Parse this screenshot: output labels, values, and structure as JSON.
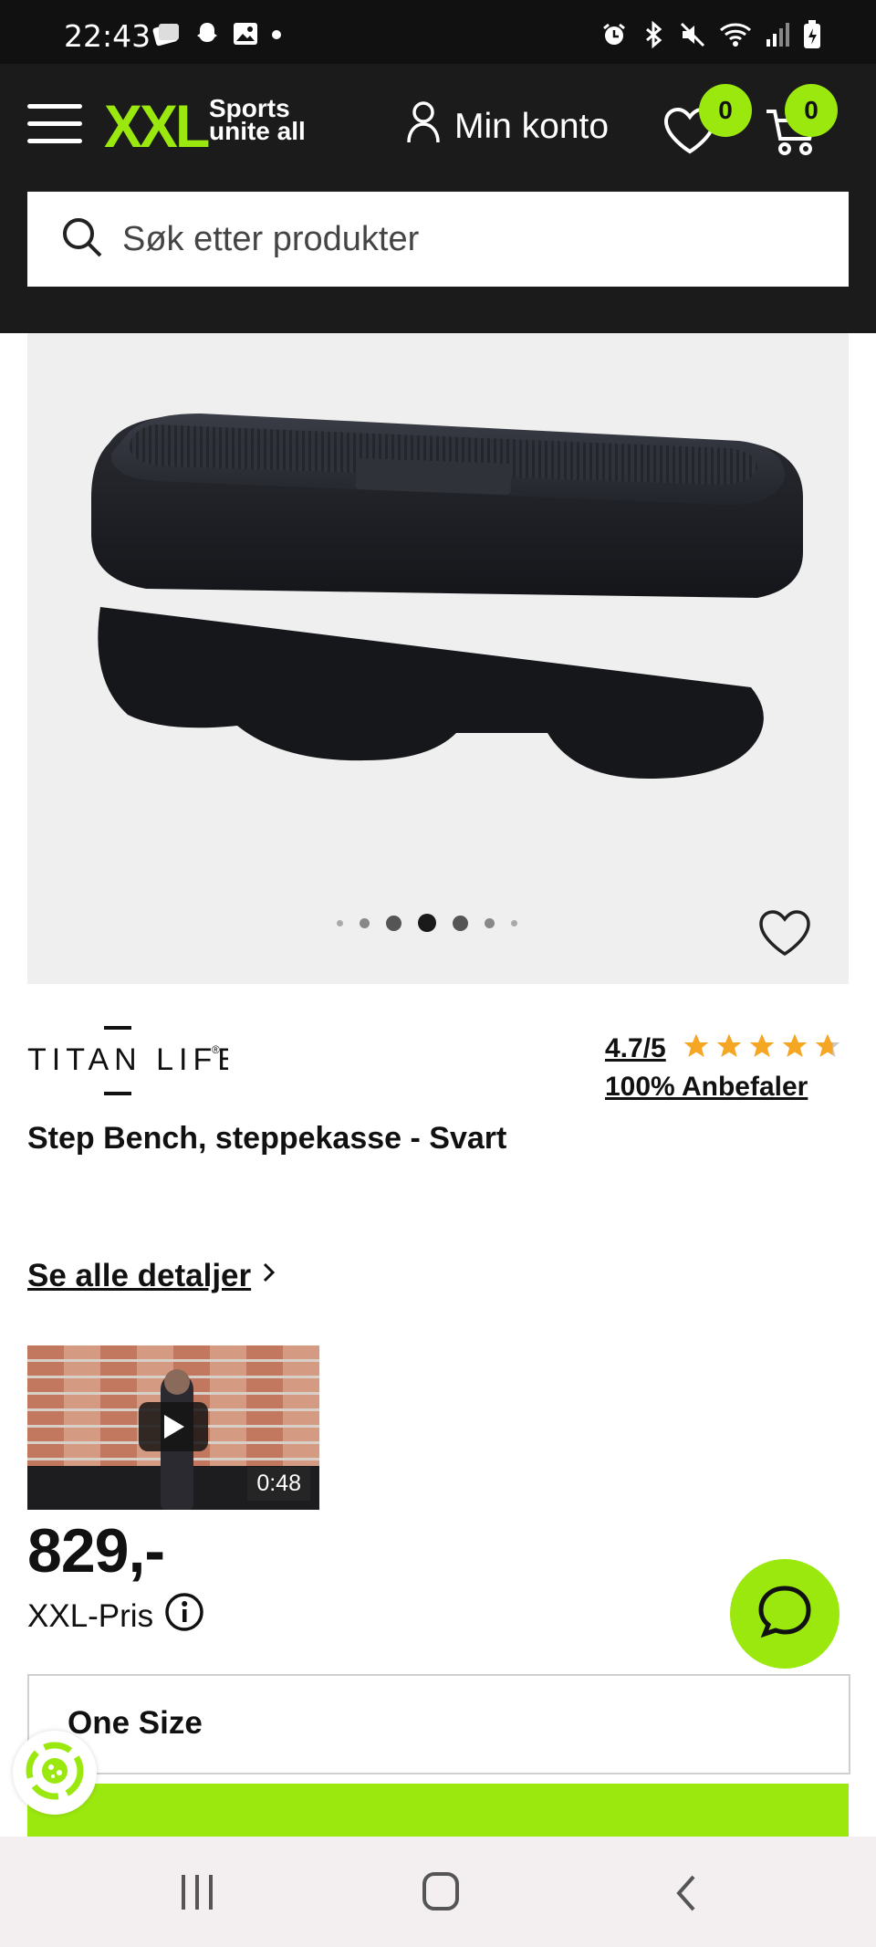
{
  "status_bar": {
    "time": "22:43",
    "left_icons": [
      "gallery-notification-icon",
      "snapchat-icon",
      "image-icon",
      "dot-icon"
    ],
    "right_icons": [
      "alarm-icon",
      "bluetooth-icon",
      "mute-icon",
      "wifi-icon",
      "signal-icon",
      "battery-icon"
    ]
  },
  "header": {
    "logo_text": "XXL",
    "tagline_line1": "Sports",
    "tagline_line2": "unite all",
    "account_label": "Min konto",
    "wishlist_count": "0",
    "cart_count": "0",
    "brand_color": "#9be80f",
    "background_color": "#1b1b1b"
  },
  "search": {
    "placeholder": "Søk etter produkter"
  },
  "gallery": {
    "image_count": 7,
    "active_index": 3
  },
  "product": {
    "brand": "TITAN LIFE",
    "rating_text": "4.7/5",
    "rating_value": 4.7,
    "recommend_text": "100% Anbefaler",
    "title": "Step Bench, steppekasse - Svart",
    "details_link": "Se alle detaljer",
    "video_duration": "0:48",
    "price": "829,-",
    "price_label": "XXL-Pris",
    "size_selected": "One Size"
  },
  "system_nav": {
    "buttons": [
      "recent-apps-button",
      "home-button",
      "back-button"
    ]
  }
}
